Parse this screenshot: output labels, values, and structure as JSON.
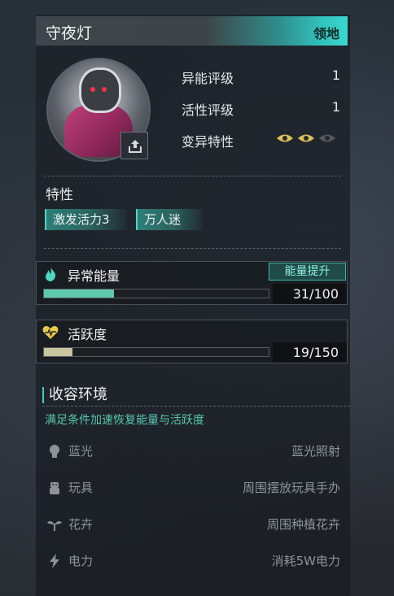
{
  "header": {
    "title": "守夜灯",
    "tag": "领地"
  },
  "stats": [
    {
      "label": "异能评级",
      "value": "1"
    },
    {
      "label": "活性评级",
      "value": "1"
    },
    {
      "label": "变异特性",
      "value": ""
    }
  ],
  "mutation_level": {
    "active": 2,
    "total": 3
  },
  "traits": {
    "label": "特性",
    "items": [
      "激发活力3",
      "万人迷"
    ]
  },
  "energy": {
    "label": "异常能量",
    "button": "能量提升",
    "current": 31,
    "max": 100,
    "display": "31/100",
    "color": "#5fc9ad"
  },
  "activity": {
    "label": "活跃度",
    "current": 19,
    "max": 150,
    "display": "19/150",
    "color": "#c8c5a0"
  },
  "containment": {
    "title": "收容环境",
    "description": "满足条件加速恢复能量与活跃度",
    "conditions": [
      {
        "icon": "lightbulb-icon",
        "name": "蓝光",
        "requirement": "蓝光照射"
      },
      {
        "icon": "toy-icon",
        "name": "玩具",
        "requirement": "周围摆放玩具手办"
      },
      {
        "icon": "plant-icon",
        "name": "花卉",
        "requirement": "周围种植花卉"
      },
      {
        "icon": "lightning-icon",
        "name": "电力",
        "requirement": "消耗5W电力"
      }
    ]
  }
}
